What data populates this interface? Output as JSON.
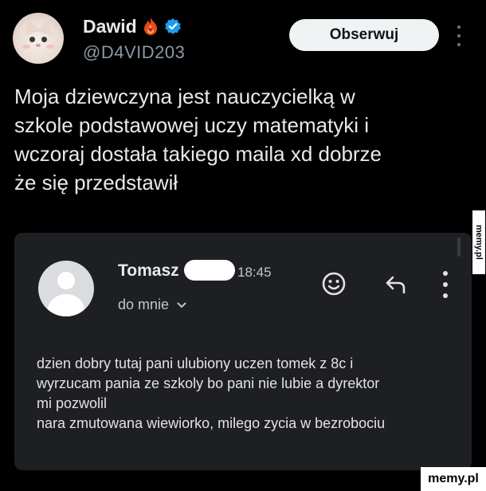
{
  "tweet": {
    "author": {
      "display_name": "Dawid",
      "handle": "@D4VID203",
      "name_emoji": "flame-heart-icon",
      "verified_icon": "verified-badge-icon",
      "verified_color": "#1d9bf0"
    },
    "follow_label": "Obserwuj",
    "text": "Moja dziewczyna jest nauczycielką w\nszkole podstawowej uczy matematyki i\nwczoraj dostała takiego maila xd dobrze\nże się przedstawił"
  },
  "email": {
    "sender_name": "Tomasz",
    "time": "18:45",
    "recipient": "do mnie",
    "icons": [
      "emoji-icon",
      "reply-icon",
      "more-icon"
    ],
    "body": "dzien dobry tutaj pani ulubiony uczen tomek z 8c i\nwyrzucam pania ze szkoly bo pani nie lubie a dyrektor\nmi pozwolil\nnara zmutowana wiewiorko, milego zycia  w bezrobociu"
  },
  "watermarks": {
    "side": "memy.pl",
    "bottom": "memy.pl"
  }
}
